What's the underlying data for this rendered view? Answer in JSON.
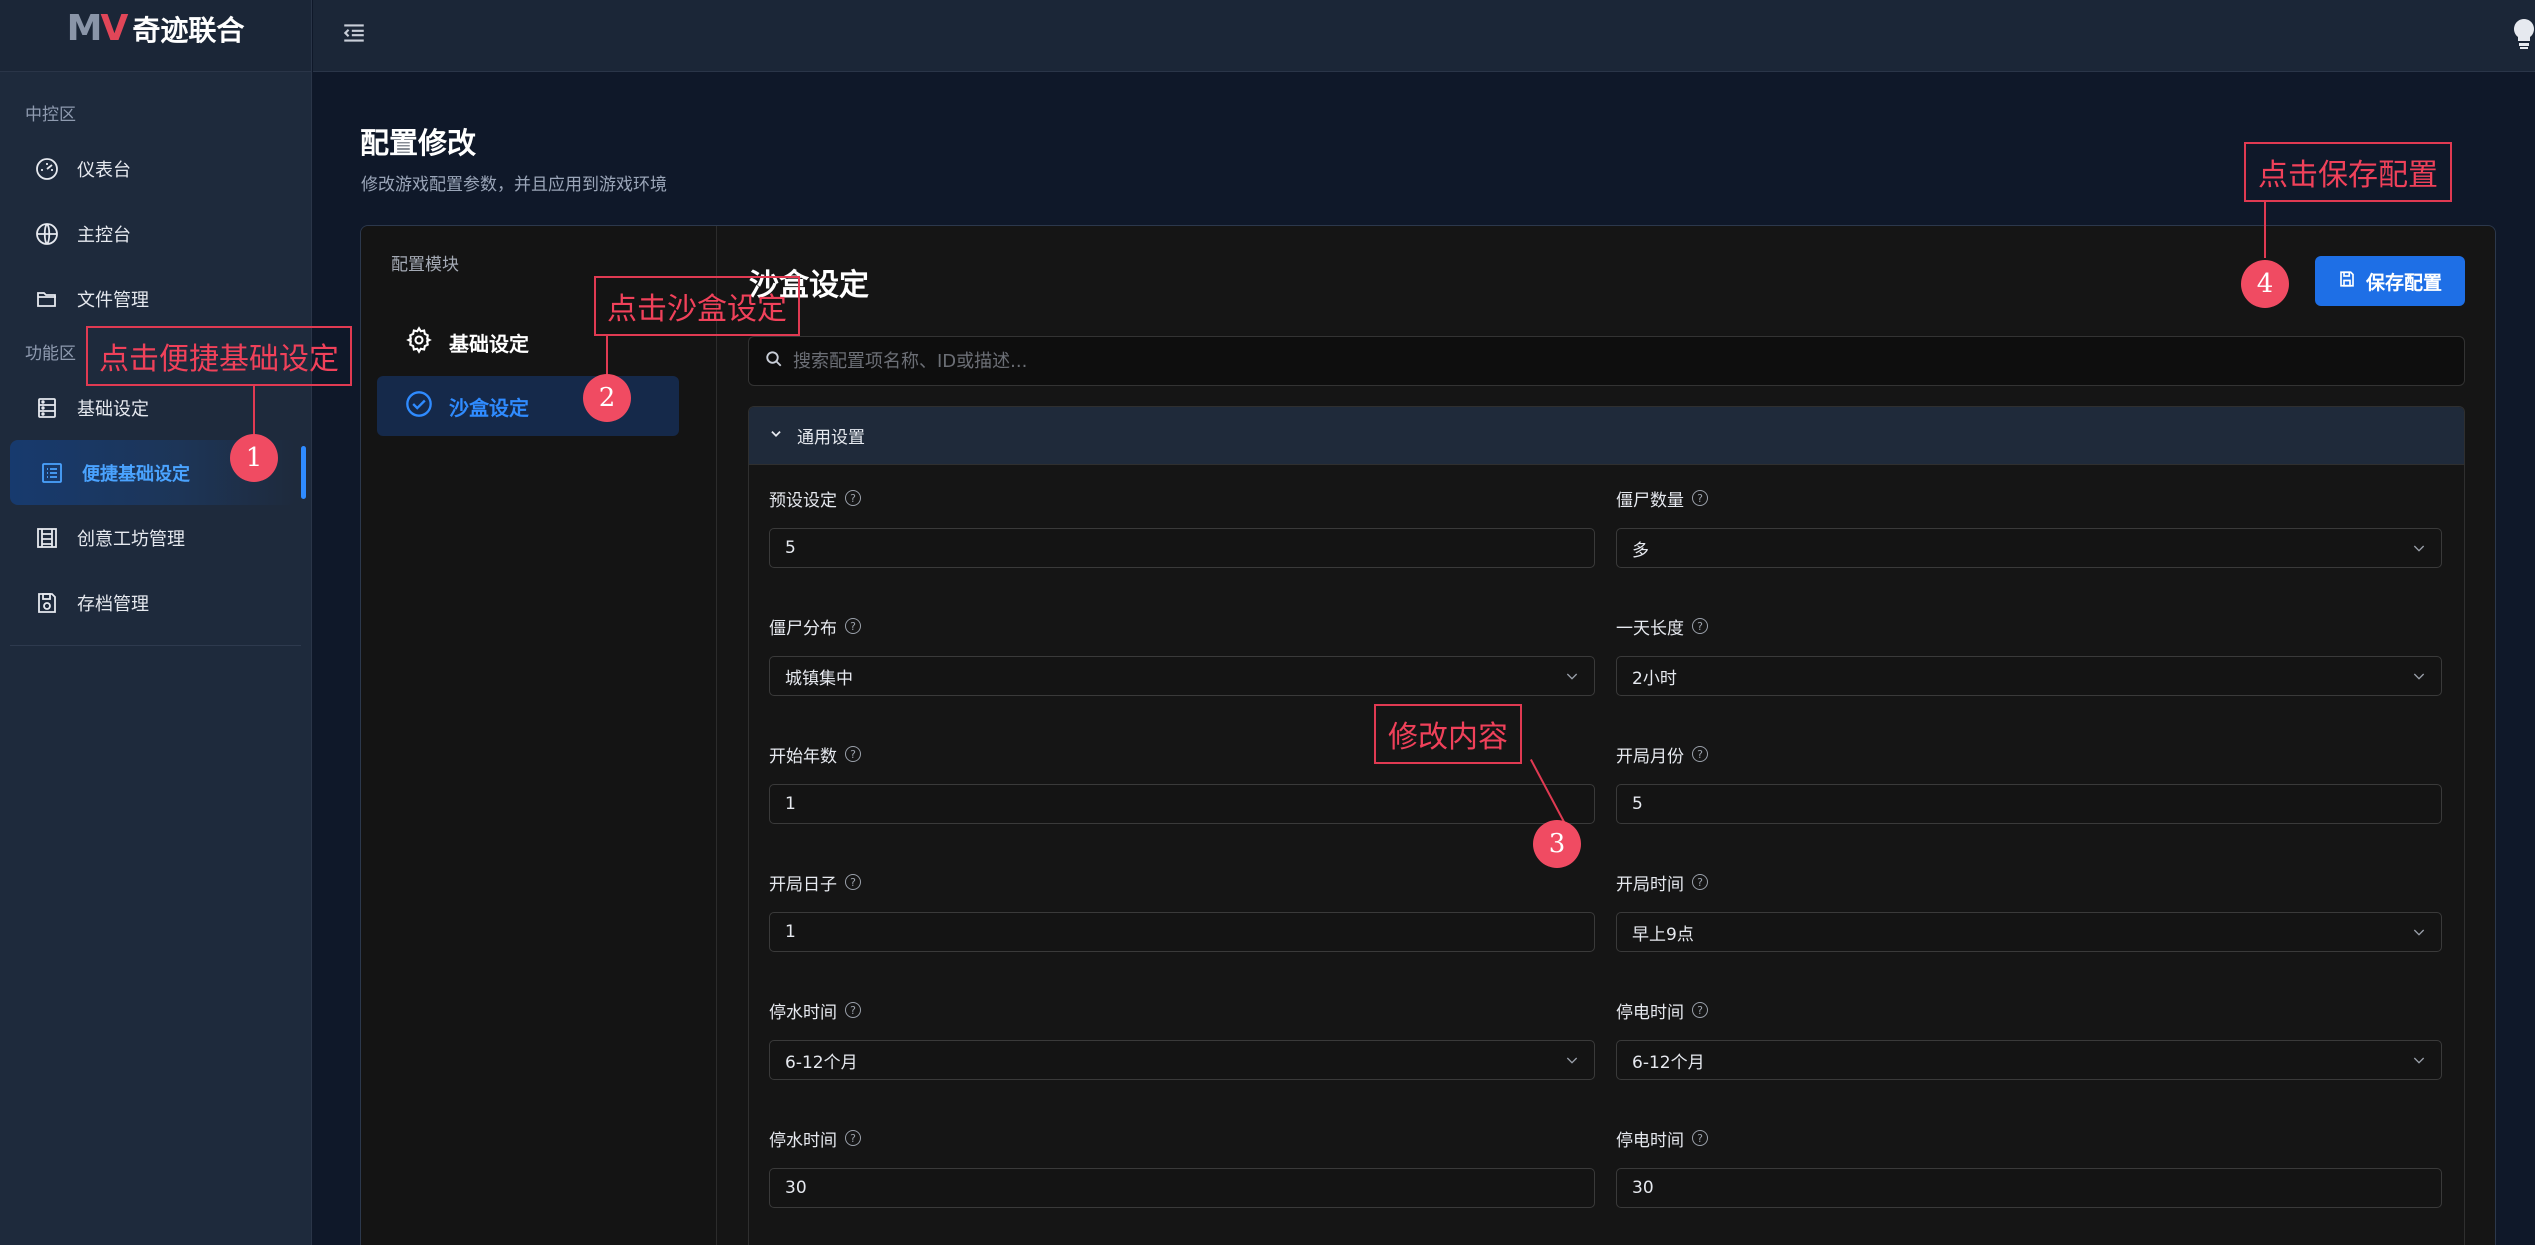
{
  "brand": {
    "logo_mark": "MV",
    "name": "奇迹联合"
  },
  "sidebar": {
    "sections": [
      {
        "title": "中控区",
        "items": [
          {
            "label": "仪表台",
            "icon": "gauge-icon"
          },
          {
            "label": "主控台",
            "icon": "globe-icon"
          },
          {
            "label": "文件管理",
            "icon": "folder-icon"
          }
        ]
      },
      {
        "title": "功能区",
        "items": [
          {
            "label": "基础设定",
            "icon": "server-icon"
          },
          {
            "label": "便捷基础设定",
            "icon": "list-icon",
            "active": true
          },
          {
            "label": "创意工坊管理",
            "icon": "building-icon"
          },
          {
            "label": "存档管理",
            "icon": "save-icon"
          }
        ]
      }
    ]
  },
  "page": {
    "title": "配置修改",
    "subtitle": "修改游戏配置参数，并且应用到游戏环境"
  },
  "modules": {
    "title": "配置模块",
    "items": [
      {
        "label": "基础设定",
        "icon": "gear-icon"
      },
      {
        "label": "沙盒设定",
        "icon": "check-circle-icon",
        "active": true
      }
    ]
  },
  "content": {
    "title": "沙盒设定",
    "save_label": "保存配置",
    "search_placeholder": "搜索配置项名称、ID或描述..."
  },
  "group": {
    "title": "通用设置",
    "fields": [
      {
        "label": "预设设定",
        "value": "5",
        "type": "input"
      },
      {
        "label": "僵尸数量",
        "value": "多",
        "type": "select"
      },
      {
        "label": "僵尸分布",
        "value": "城镇集中",
        "type": "select"
      },
      {
        "label": "一天长度",
        "value": "2小时",
        "type": "select"
      },
      {
        "label": "开始年数",
        "value": "1",
        "type": "input"
      },
      {
        "label": "开局月份",
        "value": "5",
        "type": "input"
      },
      {
        "label": "开局日子",
        "value": "1",
        "type": "input"
      },
      {
        "label": "开局时间",
        "value": "早上9点",
        "type": "select"
      },
      {
        "label": "停水时间",
        "value": "6-12个月",
        "type": "select"
      },
      {
        "label": "停电时间",
        "value": "6-12个月",
        "type": "select"
      },
      {
        "label": "停水时间",
        "value": "30",
        "type": "input"
      },
      {
        "label": "停电时间",
        "value": "30",
        "type": "input"
      }
    ]
  },
  "annotations": [
    {
      "text": "点击便捷基础设定",
      "num": "1"
    },
    {
      "text": "点击沙盒设定",
      "num": "2"
    },
    {
      "text": "修改内容",
      "num": "3"
    },
    {
      "text": "点击保存配置",
      "num": "4"
    }
  ],
  "colors": {
    "accent": "#1e6fe6",
    "annotation": "#e03a52",
    "bg": "#0f1829"
  }
}
